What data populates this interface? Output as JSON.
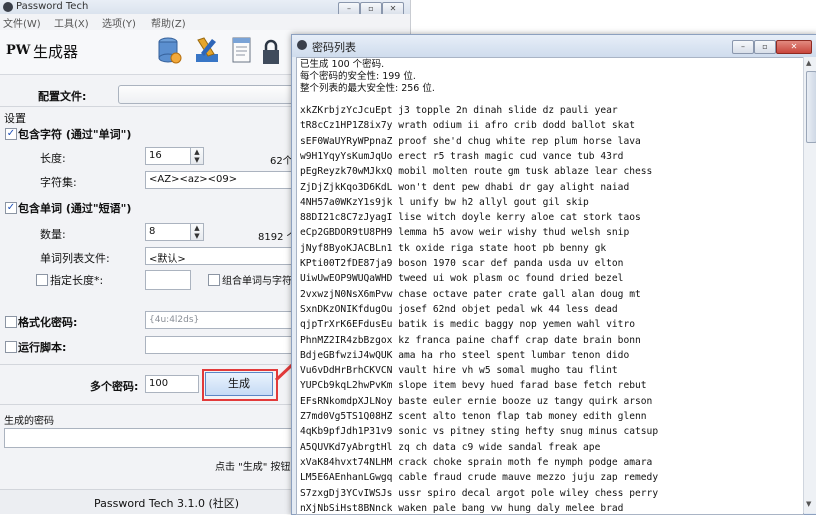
{
  "main_window": {
    "title": "Password Tech",
    "caption_buttons": [
      "–",
      "▫",
      "✕"
    ],
    "menu": [
      "文件(W)",
      "工具(X)",
      "选项(Y)",
      "帮助(Z)"
    ],
    "app_logo": "PW",
    "app_heading": "生成器",
    "profile_label": "配置文件:",
    "settings_label": "设置",
    "include_chars": {
      "label": "包含字符 (通过\"单词\")",
      "checked": true
    },
    "length_label": "长度:",
    "length_value": "16",
    "length_info": "62个",
    "charset_label": "字符集:",
    "charset_value": "<AZ><az><09>",
    "include_words": {
      "label": "包含单词 (通过\"短语\")",
      "checked": true
    },
    "count_label": "数量:",
    "count_value": "8",
    "count_info": "8192 个",
    "wordlist_label": "单词列表文件:",
    "wordlist_value": "<默认>",
    "specify_length_label": "指定长度*:",
    "combine_label": "组合单词与字符",
    "format_label": "格式化密码:",
    "format_value": "{4u:4l2ds}",
    "script_label": "运行脚本:",
    "multi_label": "多个密码:",
    "multi_value": "100",
    "generate_label": "生成",
    "generated_label": "生成的密码",
    "hint_text": "点击 \"生成\" 按钮",
    "version_label": "Password Tech 3.1.0 (社区)"
  },
  "list_window": {
    "title": "密码列表",
    "summary": [
      "已生成 100 个密码.",
      "每个密码的安全性: 199 位.",
      "整个列表的最大安全性: 256 位."
    ],
    "passwords": [
      "xkZKrbjzYcJcuEpt j3 topple 2n dinah slide dz pauli year",
      "tR8cCz1HP1Z8ix7y wrath odium ii afro crib dodd ballot skat",
      "sEF0WaUYRyWPpnaZ proof she'd chug white rep plum horse lava",
      "w9H1YqyYsKumJqUo erect r5 trash magic cud vance tub 43rd",
      "pEgReyzk70wMJkxQ mobil molten route gm tusk ablaze lear chess",
      "ZjDjZjkKqo3D6KdL won't dent pew dhabi dr gay alight naiad",
      "4NH57a0WKzY1s9jk l unify bw h2 allyl gout gil skip",
      "88DI21c8C7zJyagI lise witch doyle kerry aloe cat stork taos",
      "eCp2GBDOR9tU8PH9 lemma h5 avow weir wishy thud welsh snip",
      "jNyf8ByoKJACBLn1 tk oxide riga state hoot pb benny gk",
      "KPti00T2fDE87ja9 boson 1970 scar def panda usda uv elton",
      "UiwUwEOP9WUQaWHD tweed ui wok plasm oc found dried bezel",
      "2vxwzjN0NsX6mPvw chase octave pater crate gall alan doug mt",
      "SxnDKzONIKfdugOu josef 62nd objet pedal wk 44 less dead",
      "qjpTrXrK6EFdusEu batik is medic baggy nop yemen wahl vitro",
      "PhnMZ2IR4zbBzgox kz franca paine chaff crap date brain bonn",
      "BdjeGBfwziJ4wQUK ama ha rho steel spent lumbar tenon dido",
      "Vu6vDdHrBrhCKVCN vault hire vh w5 somal mugho tau flint",
      "YUPCb9kqL2hwPvKm slope item bevy hued farad base fetch rebut",
      "EFsRNkomdpXJLNoy baste euler ernie booze uz tangy quirk arson",
      "Z7md0Vg5TS1Q08HZ scent alto tenon flap tab money edith glenn",
      "4qKb9pfJdh1P31v9 sonic vs pitney sting hefty snug minus catsup",
      "A5QUVKd7yAbrgtHl zq ch data c9 wide sandal freak ape",
      "xVaK84hvxt74NLHM crack choke sprain moth fe nymph podge amara",
      "LM5E6AEnhanLGwgq cable fraud crude mauve mezzo juju zap remedy",
      "S7zxgDj3YCvIWSJs ussr spiro decal argot pole wiley chess perry",
      "nXjNbSiHst8BNnck waken pale bang vw hung daly melee brad"
    ]
  },
  "colors": {
    "accent": "#1d4fb8",
    "highlight": "#e23a3a",
    "close": "#c9463d"
  },
  "icons": [
    "app-logo-icon",
    "database-icon",
    "tools-icon",
    "document-icon",
    "lock-icon",
    "scroll-up-icon",
    "scroll-down-icon"
  ]
}
